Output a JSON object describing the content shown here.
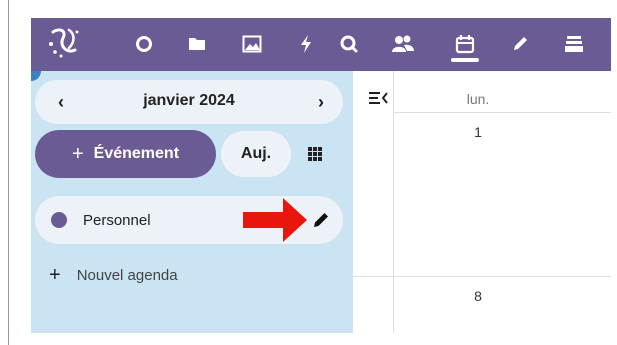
{
  "topbar": {
    "bg_color": "#6b5b95",
    "icons": [
      "logo-icon",
      "circle-icon",
      "folder-icon",
      "image-icon",
      "lightning-icon",
      "search-icon",
      "contacts-icon",
      "calendar-icon",
      "pencil-icon",
      "archive-icon"
    ],
    "active": "calendar-icon"
  },
  "sidebar": {
    "month_label": "janvier 2024",
    "prev": "‹",
    "next": "›",
    "new_event_plus": "+",
    "new_event_label": "Événement",
    "today_label": "Auj.",
    "calendars": [
      {
        "name": "Personnel",
        "color": "#6b5b95"
      }
    ],
    "new_calendar_plus": "+",
    "new_calendar_label": "Nouvel agenda",
    "bg_color": "#cbe4f3"
  },
  "main": {
    "day_header": "lun.",
    "dates": [
      "1",
      "8"
    ]
  },
  "annotation": {
    "arrow_color": "#e8160c"
  }
}
